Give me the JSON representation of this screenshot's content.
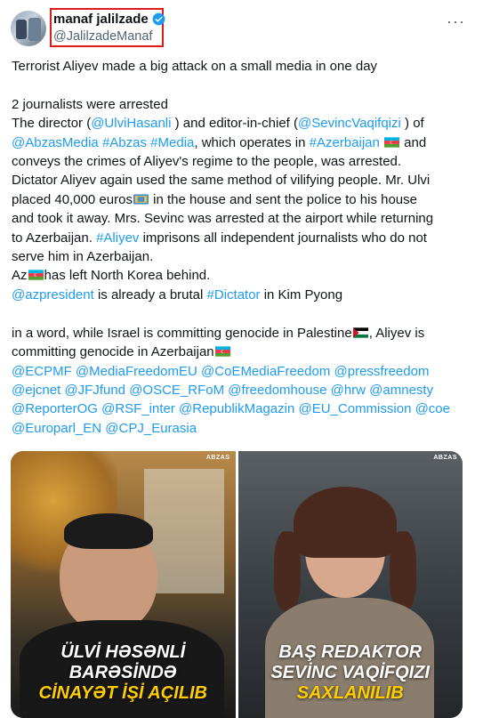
{
  "author": {
    "display_name": "manaf jalilzade",
    "handle": "@JalilzadeManaf",
    "more_icon": "···"
  },
  "tweet": {
    "p1": "Terrorist Aliyev made a big attack on a small media in one day",
    "p2": "2 journalists were arrested",
    "t1": "The director (",
    "m1": "@UlviHasanli",
    "t2": " ) and editor-in-chief (",
    "m2": "@SevincVaqifqizi",
    "t3": " ) of",
    "m3": "@AbzasMedia",
    "h1": "#Abzas",
    "h2": "#Media",
    "t4": ", which operates in ",
    "h3": "#Azerbaijan",
    "t5": " and",
    "t6": "conveys the crimes of Aliyev's regime to the people, was arrested.",
    "t7": "Dictator Aliyev again used the same method of vilifying people. Mr. Ulvi",
    "t8": "placed 40,000 euros",
    "t9": " in the house and sent the police to his house",
    "t10": "and took it away. Mrs. Sevinc was arrested at the airport while returning",
    "t11": "to Azerbaijan. ",
    "h4": "#Aliyev",
    "t12": " imprisons all independent journalists who do not",
    "t13": "serve him in Azerbaijan.",
    "t14a": "Az",
    "t14b": "has left North Korea behind.",
    "m4": "@azpresident",
    "t15": " is already a brutal ",
    "h5": "#Dictator",
    "t16": " in Kim Pyong",
    "t17": "in a word, while Israel is committing genocide in Palestine",
    "t18": ", Aliyev is",
    "t19": "committing genocide in Azerbaijan",
    "mentions_line1": [
      "@ECPMF",
      "@MediaFreedomEU",
      "@CoEMediaFreedom",
      "@pressfreedom"
    ],
    "mentions_line2": [
      "@ejcnet",
      "@JFJfund",
      "@OSCE_RFoM",
      "@freedomhouse",
      "@hrw",
      "@amnesty"
    ],
    "mentions_line3": [
      "@ReporterOG",
      "@RSF_inter",
      "@RepublikMagazin",
      "@EU_Commission",
      "@coe"
    ],
    "mentions_line4": [
      "@Europarl_EN",
      "@CPJ_Eurasia"
    ]
  },
  "media": {
    "watermark": "ABZAS",
    "left": {
      "line1": "ÜLVİ HƏSƏNLİ",
      "line2": "BARƏSİNDƏ",
      "line3": "CİNAYƏT İŞİ AÇILIB"
    },
    "right": {
      "line1": "BAŞ REDAKTOR",
      "line2": "SEVİNC VAQİFQIZI",
      "line3": "SAXLANILIB"
    }
  },
  "colors": {
    "link": "#1d9bf0",
    "text": "#0f1419",
    "secondary": "#536471",
    "highlight_box": "#e0191a",
    "caption_yellow": "#ffcc00"
  }
}
